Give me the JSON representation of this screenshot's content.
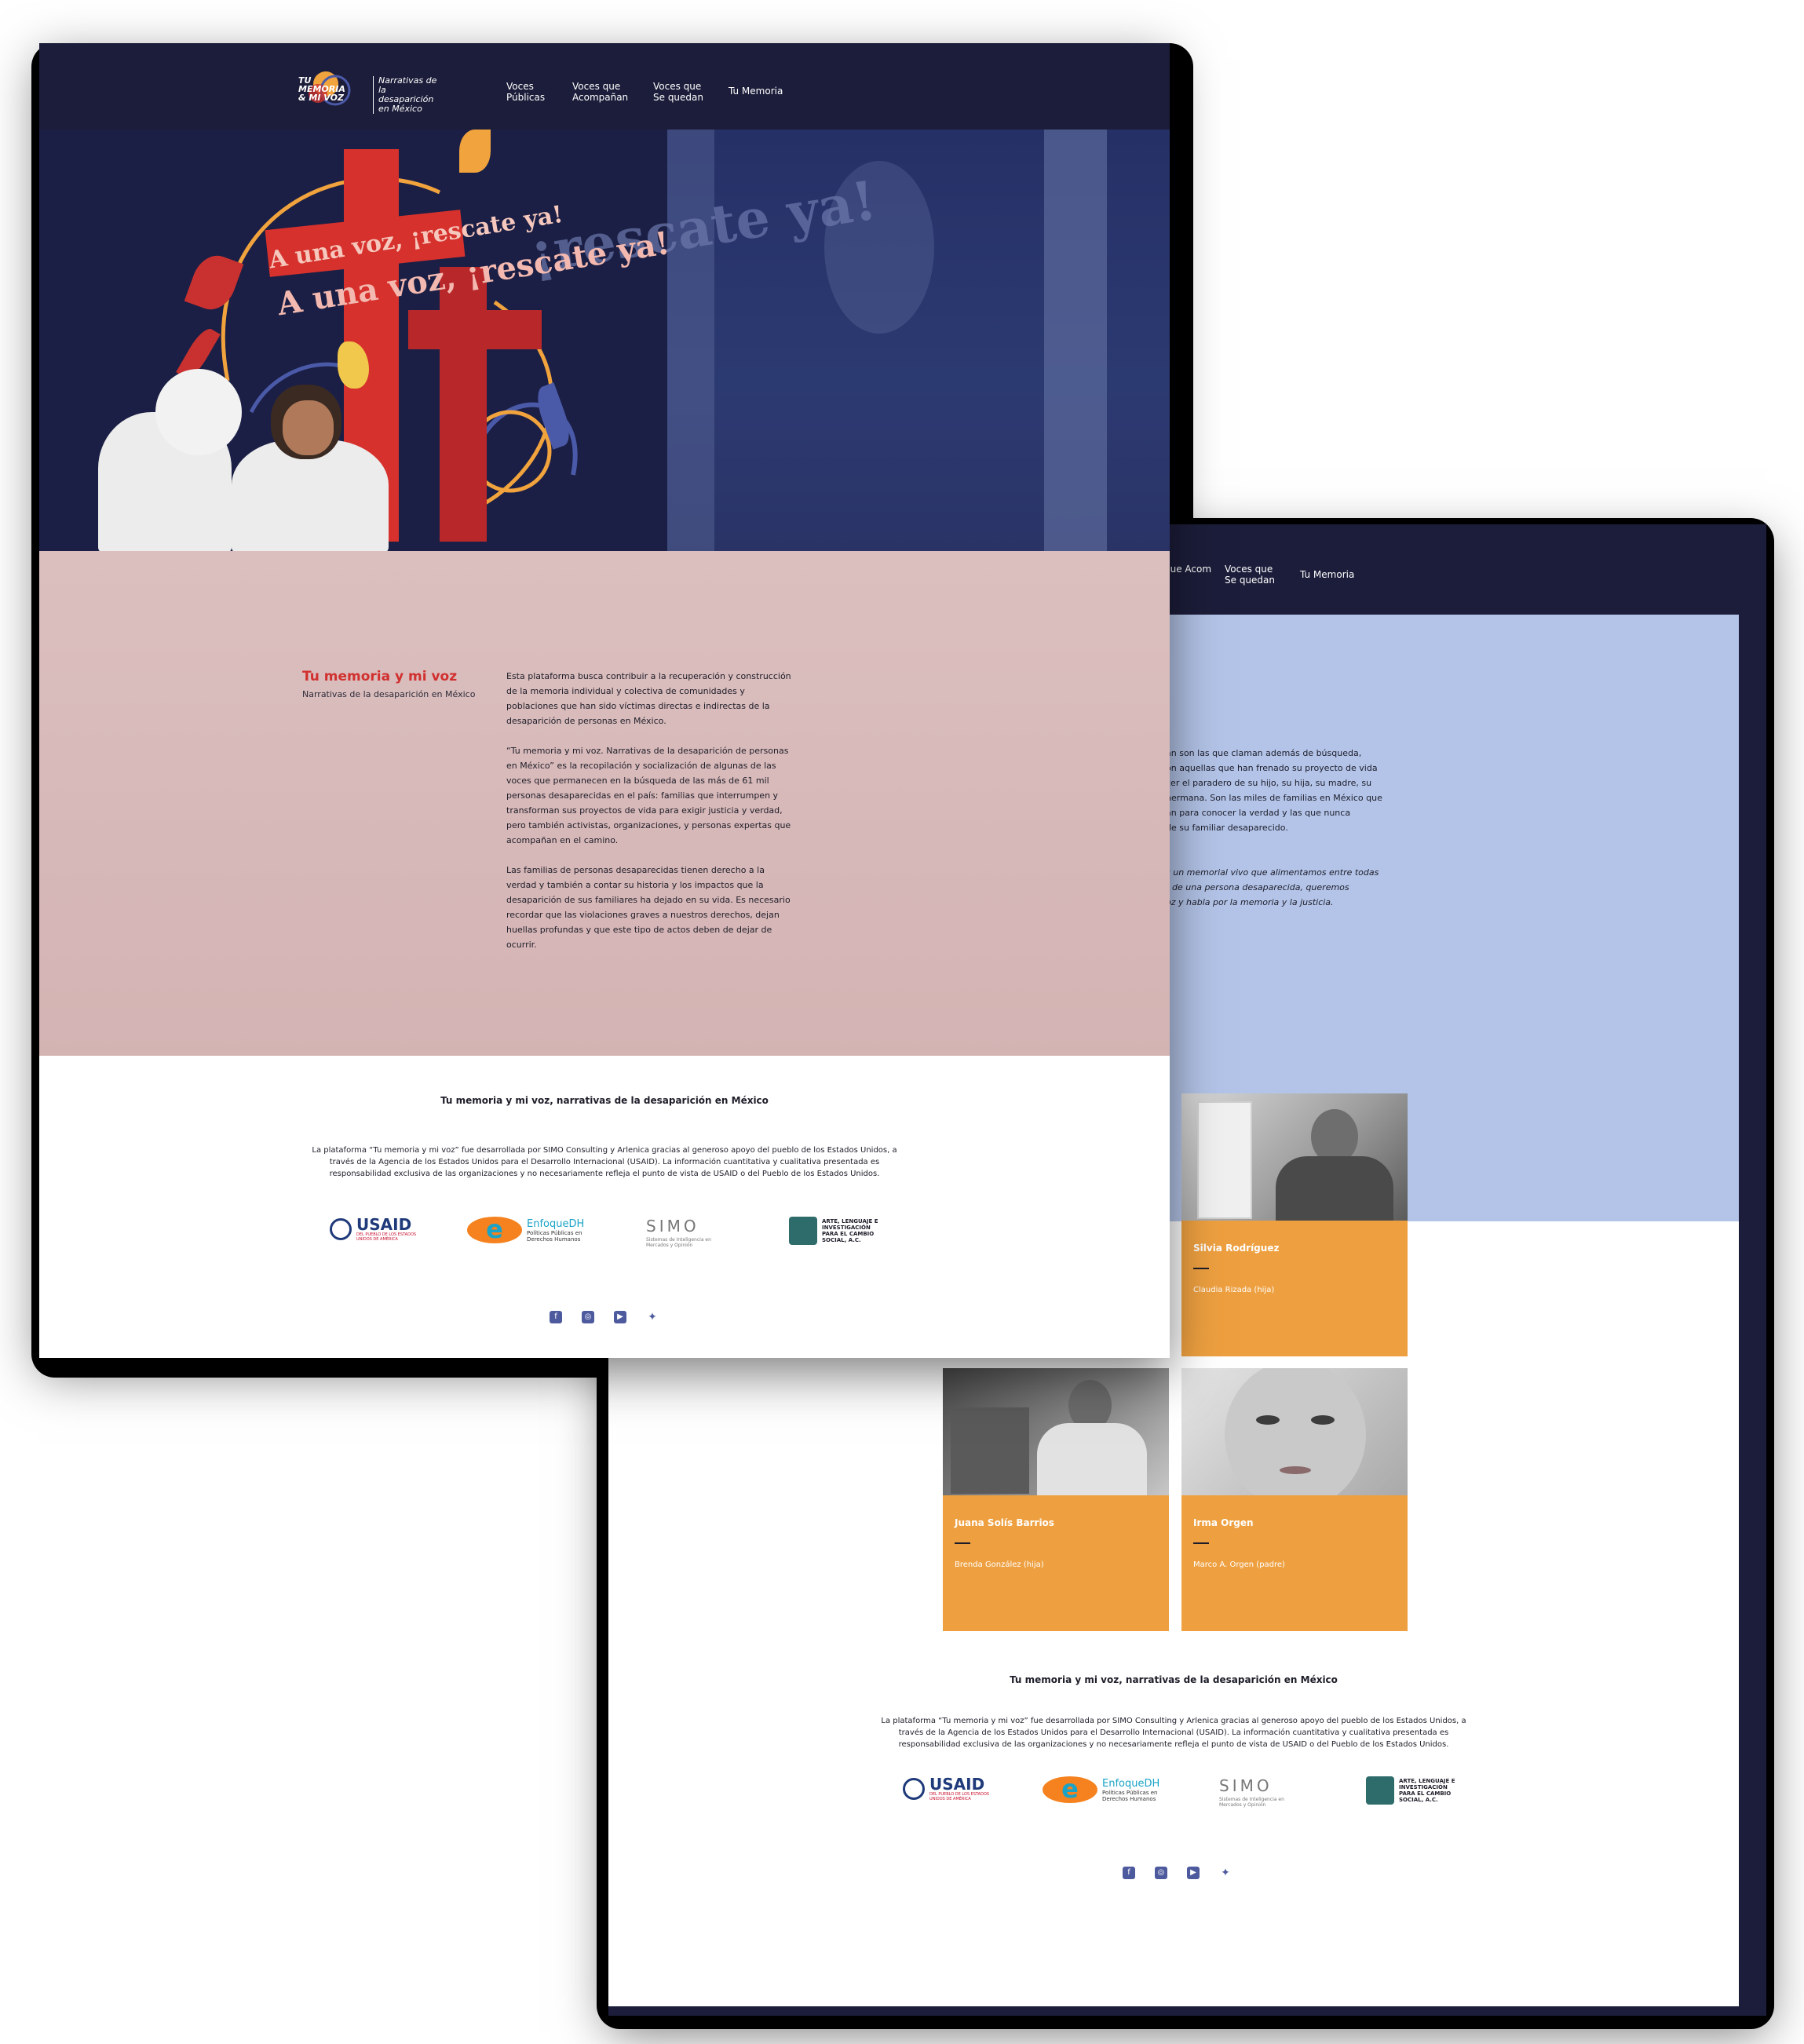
{
  "brand": {
    "logo_text": "TU MEMORIA & MI VOZ",
    "tagline": "Narrativas de la desaparición en México"
  },
  "nav": {
    "items": [
      "Voces Públicas",
      "Voces que Acompañan",
      "Voces que Se quedan",
      "Tu Memoria"
    ]
  },
  "back_nav": {
    "items": [
      "que Acompañan",
      "Voces que Se quedan",
      "Tu Memoria"
    ]
  },
  "hero": {
    "headline_small": "A una voz, ¡rescate ya!",
    "headline_large": "A una voz, ¡rescate ya!",
    "headline_bg": "¡rescate ya!"
  },
  "about": {
    "title": "Tu memoria y mi voz",
    "subtitle": "Narrativas de la desaparición en México",
    "paragraphs": [
      "Esta plataforma busca contribuir a la recuperación y construcción de la memoria individual y colectiva de comunidades y poblaciones que han sido víctimas directas e indirectas de la desaparición de personas en México.",
      "“Tu memoria y mi voz. Narrativas de la desaparición de personas en México” es la recopilación y socialización de algunas de las voces que permanecen en la búsqueda de las más de 61 mil personas desaparecidas en el país: familias que interrumpen y transforman sus proyectos de vida para exigir justicia y verdad, pero también activistas, organizaciones, y personas expertas que acompañan en el camino.",
      "Las familias de personas desaparecidas tienen derecho a la verdad y también a contar su historia y los impactos que la desaparición de sus familiares ha dejado en su vida. Es necesario recordar que las violaciones graves a nuestros derechos, dejan huellas profundas y que este tipo de actos deben de dejar de ocurrir."
    ]
  },
  "footer": {
    "title": "Tu memoria y mi voz, narrativas de la desaparición en México",
    "text": "La plataforma “Tu memoria y mi voz” fue desarrollada por SIMO Consulting y Arlenica gracias al generoso apoyo del pueblo de los Estados Unidos, a través de la Agencia de los Estados Unidos para el Desarrollo Internacional (USAID). La información cuantitativa y cualitativa presentada es responsabilidad exclusiva de las organizaciones y no necesariamente refleja el punto de vista de USAID o del Pueblo de los Estados Unidos.",
    "partners": [
      {
        "name": "USAID",
        "sub": "DEL PUEBLO DE LOS ESTADOS UNIDOS DE AMÉRICA"
      },
      {
        "name": "EnfoqueDH",
        "sub": "Políticas Públicas en Derechos Humanos"
      },
      {
        "name": "SIMO",
        "sub": "Sistemas de Inteligencia en Mercados y Opinión"
      },
      {
        "name": "ARTE, LENGUAJE E INVESTIGACIÓN PARA EL CAMBIO SOCIAL, A.C.",
        "sub": ""
      }
    ],
    "social": [
      "facebook-icon",
      "instagram-icon",
      "youtube-icon",
      "twitter-icon"
    ]
  },
  "back_page": {
    "text_lines": [
      "an son las que claman además de búsqueda,",
      "on aquellas que han frenado su proyecto de vida",
      "cer el paradero de su hijo, su hija, su madre, su",
      "hermana. Son las miles de familias en México que",
      "an para conocer la verdad y las que nunca",
      "de su familiar desaparecido."
    ],
    "italic_lines": [
      "s un memorial vivo que alimentamos entre todas",
      "r de una persona desaparecida, queremos",
      "oz y habla por la memoria y la justicia."
    ],
    "cards": [
      {
        "name": "Silvia Rodríguez",
        "relation": "Claudia Rizada (hija)"
      },
      {
        "name": "Juana Solís Barrios",
        "relation": "Brenda González (hija)"
      },
      {
        "name": "Irma Orgen",
        "relation": "Marco A. Orgen (padre)"
      }
    ]
  },
  "colors": {
    "navy": "#1c1d3a",
    "red": "#d1302e",
    "pink": "#d8baba",
    "blue": "#b3c4e8",
    "orange": "#eea040"
  }
}
